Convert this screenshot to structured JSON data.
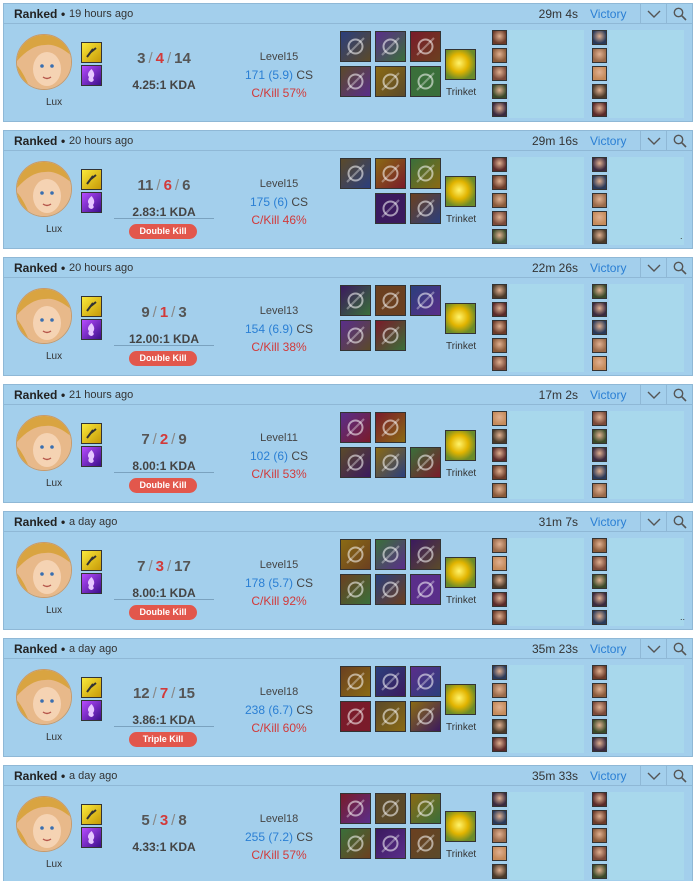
{
  "matches": [
    {
      "type": "Ranked",
      "ago": "19 hours ago",
      "duration": "29m 4s",
      "result": "Victory",
      "champion": "Lux",
      "k": "4",
      "kda_k": "3",
      "kda_d": "4",
      "kda_a": "14",
      "ratio": "4.25:1 KDA",
      "multikill": "",
      "level": "Level15",
      "cs": "171 (5.9)",
      "cs_unit": "CS",
      "ckill": "C/Kill 57%",
      "trinket": "Trinket",
      "extra": ""
    },
    {
      "type": "Ranked",
      "ago": "20 hours ago",
      "duration": "29m 16s",
      "result": "Victory",
      "champion": "Lux",
      "kda_k": "11",
      "kda_d": "6",
      "kda_a": "6",
      "ratio": "2.83:1 KDA",
      "multikill": "Double Kill",
      "level": "Level15",
      "cs": "175 (6)",
      "cs_unit": "CS",
      "ckill": "C/Kill 46%",
      "trinket": "Trinket",
      "extra": "."
    },
    {
      "type": "Ranked",
      "ago": "20 hours ago",
      "duration": "22m 26s",
      "result": "Victory",
      "champion": "Lux",
      "kda_k": "9",
      "kda_d": "1",
      "kda_a": "3",
      "ratio": "12.00:1 KDA",
      "multikill": "Double Kill",
      "level": "Level13",
      "cs": "154 (6.9)",
      "cs_unit": "CS",
      "ckill": "C/Kill 38%",
      "trinket": "Trinket",
      "extra": ""
    },
    {
      "type": "Ranked",
      "ago": "21 hours ago",
      "duration": "17m 2s",
      "result": "Victory",
      "champion": "Lux",
      "kda_k": "7",
      "kda_d": "2",
      "kda_a": "9",
      "ratio": "8.00:1 KDA",
      "multikill": "Double Kill",
      "level": "Level11",
      "cs": "102 (6)",
      "cs_unit": "CS",
      "ckill": "C/Kill 53%",
      "trinket": "Trinket",
      "extra": ""
    },
    {
      "type": "Ranked",
      "ago": "a day ago",
      "duration": "31m 7s",
      "result": "Victory",
      "champion": "Lux",
      "kda_k": "7",
      "kda_d": "3",
      "kda_a": "17",
      "ratio": "8.00:1 KDA",
      "multikill": "Double Kill",
      "level": "Level15",
      "cs": "178 (5.7)",
      "cs_unit": "CS",
      "ckill": "C/Kill 92%",
      "trinket": "Trinket",
      "extra": ".."
    },
    {
      "type": "Ranked",
      "ago": "a day ago",
      "duration": "35m 23s",
      "result": "Victory",
      "champion": "Lux",
      "kda_k": "12",
      "kda_d": "7",
      "kda_a": "15",
      "ratio": "3.86:1 KDA",
      "multikill": "Triple Kill",
      "level": "Level18",
      "cs": "238 (6.7)",
      "cs_unit": "CS",
      "ckill": "C/Kill 60%",
      "trinket": "Trinket",
      "extra": ""
    },
    {
      "type": "Ranked",
      "ago": "a day ago",
      "duration": "35m 33s",
      "result": "Victory",
      "champion": "Lux",
      "kda_k": "5",
      "kda_d": "3",
      "kda_a": "8",
      "ratio": "4.33:1 KDA",
      "multikill": "",
      "level": "Level18",
      "cs": "255 (7.2)",
      "cs_unit": "CS",
      "ckill": "C/Kill 57%",
      "trinket": "Trinket",
      "extra": ""
    }
  ],
  "icons": {
    "expand": "chevron-down-icon",
    "details": "magnifier-icon",
    "spell_1": "flash-spell-icon",
    "spell_2": "ignite-spell-icon",
    "trinket": "trinket-ward-icon"
  },
  "colors": {
    "panel": "#a3cfec",
    "victory": "#2a7fd4",
    "deaths": "#d23a3a",
    "multikill_badge": "#e2574c"
  }
}
